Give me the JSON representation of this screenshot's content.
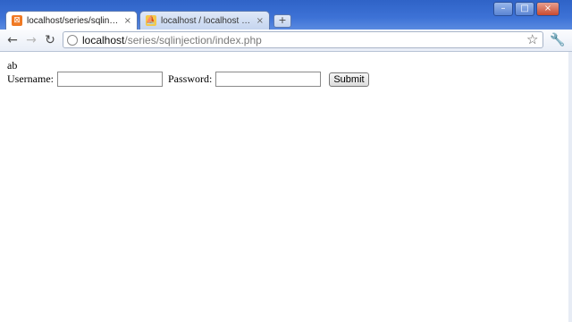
{
  "tabs": [
    {
      "label": "localhost/series/sqlinjecti...",
      "close": "×",
      "icon": "xampp-icon",
      "active": true
    },
    {
      "label": "localhost / localhost / a_...",
      "close": "×",
      "icon": "phpmyadmin-icon",
      "active": false
    }
  ],
  "new_tab": "+",
  "window_controls": {
    "minimize": "–",
    "maximize": "□",
    "close": "×"
  },
  "toolbar": {
    "back": "←",
    "forward": "→",
    "reload": "↻",
    "url_host": "localhost",
    "url_path": "/series/sqlinjection/index.php",
    "star": "☆",
    "wrench": "🔧"
  },
  "page": {
    "output_text": "ab",
    "username_label": "Username:",
    "username_value": "",
    "password_label": "Password:",
    "password_value": "",
    "submit_label": "Submit"
  }
}
